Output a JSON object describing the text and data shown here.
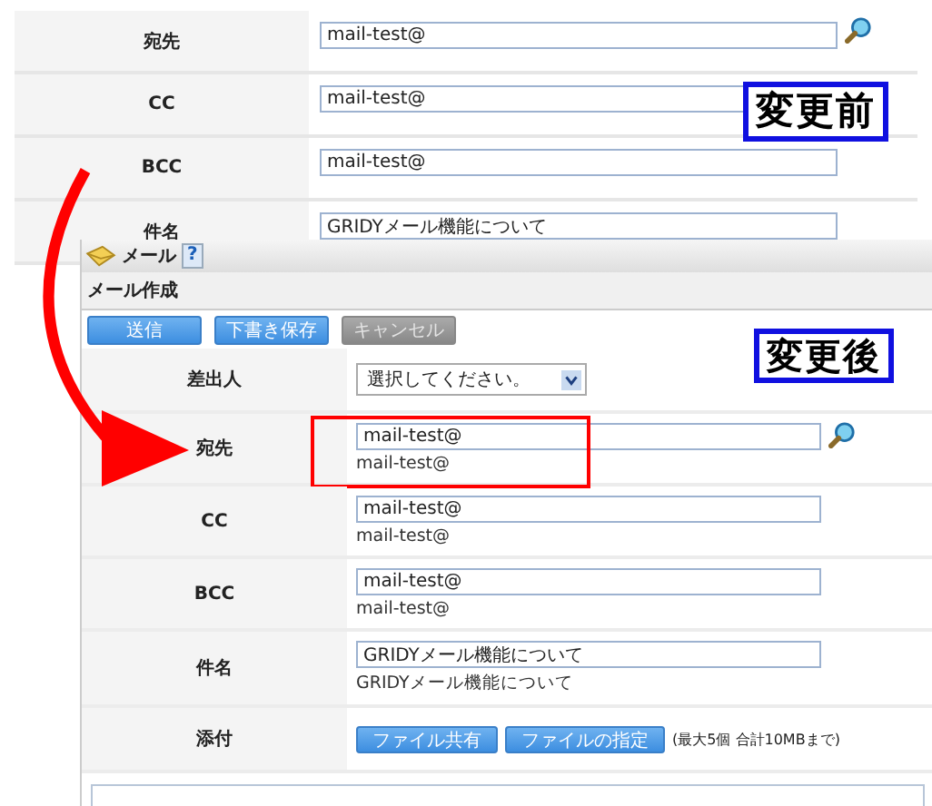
{
  "before": {
    "badge": "変更前",
    "rows": [
      {
        "label": "宛先",
        "value": "mail-test@",
        "search": true
      },
      {
        "label": "CC",
        "value": "mail-test@",
        "search": false
      },
      {
        "label": "BCC",
        "value": "mail-test@",
        "search": false
      },
      {
        "label": "件名",
        "value": "GRIDYメール機能について",
        "search": false
      }
    ]
  },
  "after": {
    "title": "メール",
    "help": "?",
    "section": "メール作成",
    "badge": "変更後",
    "buttons": [
      {
        "label": "送信",
        "disabled": false
      },
      {
        "label": "下書き保存",
        "disabled": false
      },
      {
        "label": "キャンセル",
        "disabled": true
      }
    ],
    "rows": [
      {
        "kind": "select",
        "label": "差出人",
        "value": "選択してください。"
      },
      {
        "kind": "text",
        "label": "宛先",
        "value": "mail-test@",
        "echo": "mail-test@",
        "search": true,
        "highlighted": true
      },
      {
        "kind": "text",
        "label": "CC",
        "value": "mail-test@",
        "echo": "mail-test@",
        "search": false,
        "highlighted": false
      },
      {
        "kind": "text",
        "label": "BCC",
        "value": "mail-test@",
        "echo": "mail-test@",
        "search": false,
        "highlighted": false
      },
      {
        "kind": "text",
        "label": "件名",
        "value": "GRIDYメール機能について",
        "echo": "GRIDYメール機能について",
        "search": false,
        "highlighted": false
      },
      {
        "kind": "attach",
        "label": "添付",
        "buttons": [
          "ファイル共有",
          "ファイルの指定"
        ],
        "note": "(最大5個 合計10MBまで)"
      }
    ]
  }
}
